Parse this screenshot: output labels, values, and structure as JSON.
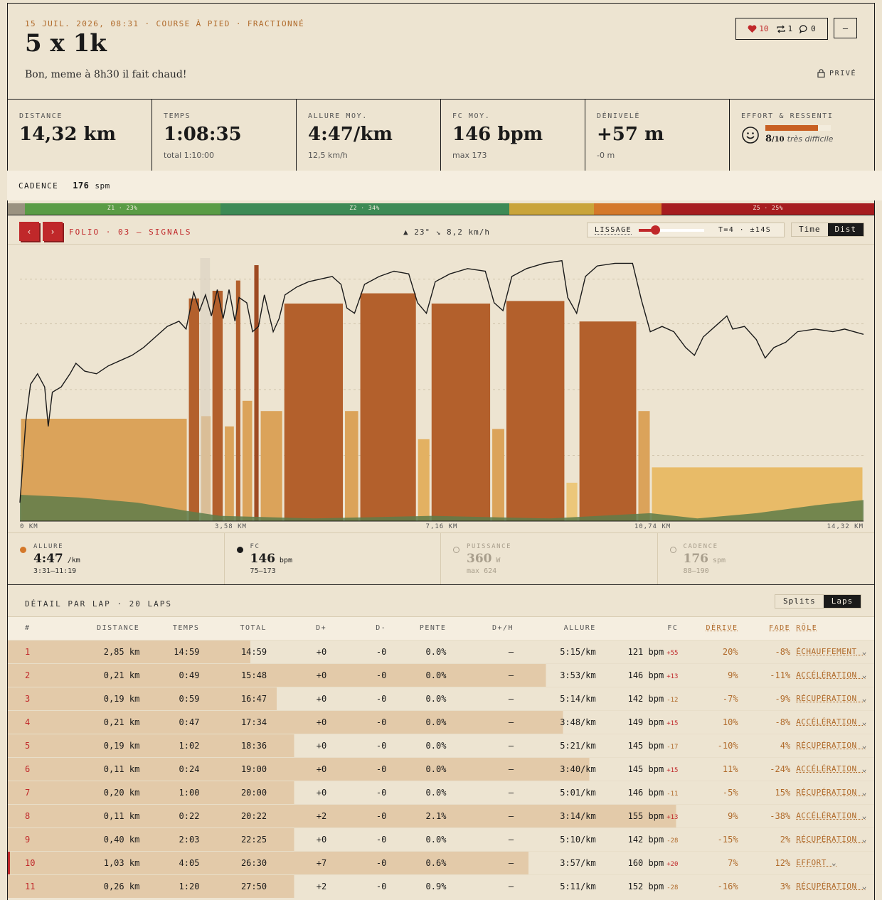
{
  "header": {
    "meta": "15 JUIL. 2026, 08:31 · COURSE À PIED · FRACTIONNÉ",
    "title": "5 x 1k",
    "description": "Bon, meme à 8h30 il fait chaud!",
    "likes": "10",
    "reposts": "1",
    "comments": "0",
    "menu_label": "–",
    "privacy": "PRIVÉ"
  },
  "stats": [
    {
      "label": "DISTANCE",
      "value": "14,32 km",
      "sub": ""
    },
    {
      "label": "TEMPS",
      "value": "1:08:35",
      "sub": "total 1:10:00"
    },
    {
      "label": "ALLURE MOY.",
      "value": "4:47/km",
      "sub": "12,5 km/h"
    },
    {
      "label": "FC MOY.",
      "value": "146 bpm",
      "sub": "max 173"
    },
    {
      "label": "DÉNIVELÉ",
      "value": "+57 m",
      "sub": "-0 m"
    }
  ],
  "effort": {
    "label": "EFFORT & RESSENTI",
    "score": "8",
    "scale": "/10",
    "text": "très difficile",
    "level": 0.8
  },
  "cadence_row": {
    "label": "CADENCE",
    "value": "176",
    "unit": "spm"
  },
  "zones": [
    {
      "label": "",
      "share": 2,
      "color": "#9a9280"
    },
    {
      "label": "Z1 · 23%",
      "share": 23,
      "color": "#5a9c45"
    },
    {
      "label": "Z2 · 34%",
      "share": 34,
      "color": "#3d8a55"
    },
    {
      "label": "",
      "share": 10,
      "color": "#c9a43a"
    },
    {
      "label": "",
      "share": 8,
      "color": "#d4782a"
    },
    {
      "label": "Z5 · 25%",
      "share": 25,
      "color": "#a61c1e"
    }
  ],
  "toolbar": {
    "prev": "‹",
    "next": "›",
    "folio": "FOLIO · 03 — SIGNALS",
    "weather": "▲ 23° ↘ 8,2 km/h",
    "lissage_label": "LISSAGE",
    "lissage_value": "T=4 · ±14S",
    "lissage_level": 0.25,
    "time_label": "Time",
    "dist_label": "Dist"
  },
  "chart_data": {
    "type": "bar",
    "x_axis_labels": [
      "0 KM",
      "3,58 KM",
      "7,16 KM",
      "10,74 KM",
      "14,32 KM"
    ],
    "xlim": [
      0,
      14.32
    ],
    "pace_bars": [
      {
        "start": 0.0,
        "end": 2.85,
        "pace": "5:15",
        "level": 0.4,
        "color": "#dba35a"
      },
      {
        "start": 2.85,
        "end": 3.06,
        "pace": "3:53",
        "level": 0.87,
        "color": "#b3602c"
      },
      {
        "start": 3.06,
        "end": 3.25,
        "pace": "5:14",
        "level": 0.41,
        "color": "#dba35a"
      },
      {
        "start": 3.25,
        "end": 3.46,
        "pace": "3:48",
        "level": 0.9,
        "color": "#b3602c"
      },
      {
        "start": 3.46,
        "end": 3.65,
        "pace": "5:21",
        "level": 0.37,
        "color": "#dba35a"
      },
      {
        "start": 3.65,
        "end": 3.76,
        "pace": "3:40",
        "level": 0.94,
        "color": "#b3602c"
      },
      {
        "start": 3.76,
        "end": 3.96,
        "pace": "5:01",
        "level": 0.47,
        "color": "#dba35a"
      },
      {
        "start": 3.96,
        "end": 4.07,
        "pace": "3:14",
        "level": 1.0,
        "color": "#9e4a22"
      },
      {
        "start": 4.07,
        "end": 4.47,
        "pace": "5:10",
        "level": 0.43,
        "color": "#dba35a"
      },
      {
        "start": 4.47,
        "end": 5.5,
        "pace": "3:57",
        "level": 0.85,
        "color": "#b3602c"
      },
      {
        "start": 5.5,
        "end": 5.76,
        "pace": "5:11",
        "level": 0.43,
        "color": "#dba35a"
      },
      {
        "start": 5.76,
        "end": 6.74,
        "pace": "3:55",
        "level": 0.89,
        "color": "#b3602c"
      },
      {
        "start": 6.74,
        "end": 6.97,
        "pace": "5:35",
        "level": 0.32,
        "color": "#e3b162"
      },
      {
        "start": 6.97,
        "end": 8.0,
        "pace": "3:58",
        "level": 0.85,
        "color": "#b3602c"
      },
      {
        "start": 8.0,
        "end": 8.24,
        "pace": "5:28",
        "level": 0.36,
        "color": "#dba35a"
      },
      {
        "start": 8.24,
        "end": 9.26,
        "pace": "3:56",
        "level": 0.86,
        "color": "#b3602c"
      },
      {
        "start": 9.26,
        "end": 9.48,
        "pace": "6:05",
        "level": 0.15,
        "color": "#ecc77a"
      },
      {
        "start": 9.48,
        "end": 10.48,
        "pace": "4:02",
        "level": 0.78,
        "color": "#b3602c"
      },
      {
        "start": 10.48,
        "end": 10.71,
        "pace": "5:08",
        "level": 0.43,
        "color": "#dba35a"
      },
      {
        "start": 10.71,
        "end": 14.32,
        "pace": "5:35",
        "level": 0.21,
        "color": "#e8bb68"
      }
    ],
    "hr_trace": [
      [
        0,
        0.07
      ],
      [
        0.1,
        0.38
      ],
      [
        0.18,
        0.52
      ],
      [
        0.3,
        0.56
      ],
      [
        0.42,
        0.51
      ],
      [
        0.48,
        0.36
      ],
      [
        0.55,
        0.49
      ],
      [
        0.7,
        0.51
      ],
      [
        0.85,
        0.56
      ],
      [
        0.95,
        0.6
      ],
      [
        1.1,
        0.57
      ],
      [
        1.3,
        0.56
      ],
      [
        1.5,
        0.59
      ],
      [
        1.7,
        0.61
      ],
      [
        1.9,
        0.63
      ],
      [
        2.1,
        0.66
      ],
      [
        2.3,
        0.7
      ],
      [
        2.5,
        0.74
      ],
      [
        2.7,
        0.76
      ],
      [
        2.82,
        0.73
      ],
      [
        2.95,
        0.87
      ],
      [
        3.05,
        0.8
      ],
      [
        3.15,
        0.86
      ],
      [
        3.25,
        0.78
      ],
      [
        3.35,
        0.88
      ],
      [
        3.45,
        0.77
      ],
      [
        3.55,
        0.88
      ],
      [
        3.65,
        0.76
      ],
      [
        3.72,
        0.85
      ],
      [
        3.85,
        0.83
      ],
      [
        3.95,
        0.72
      ],
      [
        4.05,
        0.74
      ],
      [
        4.15,
        0.86
      ],
      [
        4.3,
        0.72
      ],
      [
        4.4,
        0.77
      ],
      [
        4.5,
        0.86
      ],
      [
        4.7,
        0.89
      ],
      [
        4.9,
        0.91
      ],
      [
        5.1,
        0.92
      ],
      [
        5.3,
        0.93
      ],
      [
        5.45,
        0.9
      ],
      [
        5.55,
        0.81
      ],
      [
        5.68,
        0.79
      ],
      [
        5.85,
        0.9
      ],
      [
        6.1,
        0.93
      ],
      [
        6.35,
        0.95
      ],
      [
        6.6,
        0.94
      ],
      [
        6.75,
        0.83
      ],
      [
        6.9,
        0.79
      ],
      [
        7.05,
        0.91
      ],
      [
        7.3,
        0.94
      ],
      [
        7.6,
        0.96
      ],
      [
        7.9,
        0.95
      ],
      [
        8.05,
        0.83
      ],
      [
        8.2,
        0.8
      ],
      [
        8.35,
        0.93
      ],
      [
        8.6,
        0.96
      ],
      [
        8.9,
        0.98
      ],
      [
        9.2,
        0.99
      ],
      [
        9.3,
        0.85
      ],
      [
        9.45,
        0.79
      ],
      [
        9.6,
        0.93
      ],
      [
        9.8,
        0.97
      ],
      [
        10.1,
        0.98
      ],
      [
        10.4,
        0.98
      ],
      [
        10.55,
        0.84
      ],
      [
        10.7,
        0.72
      ],
      [
        10.9,
        0.74
      ],
      [
        11.1,
        0.72
      ],
      [
        11.3,
        0.66
      ],
      [
        11.45,
        0.63
      ],
      [
        11.6,
        0.7
      ],
      [
        11.8,
        0.74
      ],
      [
        12.0,
        0.78
      ],
      [
        12.1,
        0.73
      ],
      [
        12.3,
        0.74
      ],
      [
        12.5,
        0.69
      ],
      [
        12.65,
        0.62
      ],
      [
        12.8,
        0.66
      ],
      [
        13.0,
        0.68
      ],
      [
        13.2,
        0.72
      ],
      [
        13.5,
        0.73
      ],
      [
        13.8,
        0.72
      ],
      [
        14.0,
        0.73
      ],
      [
        14.32,
        0.71
      ]
    ],
    "elevation_fill": [
      [
        0,
        0.1
      ],
      [
        1,
        0.09
      ],
      [
        2,
        0.07
      ],
      [
        2.8,
        0.04
      ],
      [
        3.4,
        0.02
      ],
      [
        5,
        0.01
      ],
      [
        7,
        0.02
      ],
      [
        9,
        0.01
      ],
      [
        10.7,
        0.03
      ],
      [
        11.5,
        0.01
      ],
      [
        12.5,
        0.03
      ],
      [
        13.5,
        0.06
      ],
      [
        14.32,
        0.08
      ]
    ]
  },
  "metrics": [
    {
      "label": "ALLURE",
      "value": "4:47",
      "unit": "/km",
      "range": "3:31–11:19",
      "color": "#d4782a",
      "active": true
    },
    {
      "label": "FC",
      "value": "146",
      "unit": "bpm",
      "range": "75–173",
      "color": "#1a1a1a",
      "active": true
    },
    {
      "label": "PUISSANCE",
      "value": "360",
      "unit": "W",
      "range": "max 624",
      "color": "",
      "active": false
    },
    {
      "label": "CADENCE",
      "value": "176",
      "unit": "spm",
      "range": "88–190",
      "color": "",
      "active": false
    }
  ],
  "laps": {
    "title": "DÉTAIL PAR LAP · 20 LAPS",
    "splits_label": "Splits",
    "laps_label": "Laps",
    "columns": [
      "#",
      "DISTANCE",
      "TEMPS",
      "TOTAL",
      "D+",
      "D-",
      "PENTE",
      "D+/H",
      "ALLURE",
      "FC",
      "DÉRIVE",
      "FADE",
      "RÔLE"
    ],
    "rows": [
      {
        "n": "1",
        "dist": "2,85 km",
        "time": "14:59",
        "total": "14:59",
        "dp": "+0",
        "dm": "-0",
        "slope": "0.0%",
        "dph": "–",
        "pace": "5:15/km",
        "hr": "121 bpm",
        "hrd": "+55",
        "drift": "20%",
        "fade": "-8%",
        "role": "ÉCHAUFFEMENT",
        "shade": 0.28
      },
      {
        "n": "2",
        "dist": "0,21 km",
        "time": "0:49",
        "total": "15:48",
        "dp": "+0",
        "dm": "-0",
        "slope": "0.0%",
        "dph": "–",
        "pace": "3:53/km",
        "hr": "146 bpm",
        "hrd": "+13",
        "drift": "9%",
        "fade": "-11%",
        "role": "ACCÉLÉRATION",
        "shade": 0.62
      },
      {
        "n": "3",
        "dist": "0,19 km",
        "time": "0:59",
        "total": "16:47",
        "dp": "+0",
        "dm": "-0",
        "slope": "0.0%",
        "dph": "–",
        "pace": "5:14/km",
        "hr": "142 bpm",
        "hrd": "-12",
        "drift": "-7%",
        "fade": "-9%",
        "role": "RÉCUPÉRATION",
        "shade": 0.31
      },
      {
        "n": "4",
        "dist": "0,21 km",
        "time": "0:47",
        "total": "17:34",
        "dp": "+0",
        "dm": "-0",
        "slope": "0.0%",
        "dph": "–",
        "pace": "3:48/km",
        "hr": "149 bpm",
        "hrd": "+15",
        "drift": "10%",
        "fade": "-8%",
        "role": "ACCÉLÉRATION",
        "shade": 0.64
      },
      {
        "n": "5",
        "dist": "0,19 km",
        "time": "1:02",
        "total": "18:36",
        "dp": "+0",
        "dm": "-0",
        "slope": "0.0%",
        "dph": "–",
        "pace": "5:21/km",
        "hr": "145 bpm",
        "hrd": "-17",
        "drift": "-10%",
        "fade": "4%",
        "role": "RÉCUPÉRATION",
        "shade": 0.33
      },
      {
        "n": "6",
        "dist": "0,11 km",
        "time": "0:24",
        "total": "19:00",
        "dp": "+0",
        "dm": "-0",
        "slope": "0.0%",
        "dph": "–",
        "pace": "3:40/km",
        "hr": "145 bpm",
        "hrd": "+15",
        "drift": "11%",
        "fade": "-24%",
        "role": "ACCÉLÉRATION",
        "shade": 0.67
      },
      {
        "n": "7",
        "dist": "0,20 km",
        "time": "1:00",
        "total": "20:00",
        "dp": "+0",
        "dm": "-0",
        "slope": "0.0%",
        "dph": "–",
        "pace": "5:01/km",
        "hr": "146 bpm",
        "hrd": "-11",
        "drift": "-5%",
        "fade": "15%",
        "role": "RÉCUPÉRATION",
        "shade": 0.33
      },
      {
        "n": "8",
        "dist": "0,11 km",
        "time": "0:22",
        "total": "20:22",
        "dp": "+2",
        "dm": "-0",
        "slope": "2.1%",
        "dph": "–",
        "pace": "3:14/km",
        "hr": "155 bpm",
        "hrd": "+13",
        "drift": "9%",
        "fade": "-38%",
        "role": "ACCÉLÉRATION",
        "shade": 0.77
      },
      {
        "n": "9",
        "dist": "0,40 km",
        "time": "2:03",
        "total": "22:25",
        "dp": "+0",
        "dm": "-0",
        "slope": "0.0%",
        "dph": "–",
        "pace": "5:10/km",
        "hr": "142 bpm",
        "hrd": "-28",
        "drift": "-15%",
        "fade": "2%",
        "role": "RÉCUPÉRATION",
        "shade": 0.33
      },
      {
        "n": "10",
        "dist": "1,03 km",
        "time": "4:05",
        "total": "26:30",
        "dp": "+7",
        "dm": "-0",
        "slope": "0.6%",
        "dph": "–",
        "pace": "3:57/km",
        "hr": "160 bpm",
        "hrd": "+20",
        "drift": "7%",
        "fade": "12%",
        "role": "EFFORT",
        "shade": 0.6,
        "highlight": true
      },
      {
        "n": "11",
        "dist": "0,26 km",
        "time": "1:20",
        "total": "27:50",
        "dp": "+2",
        "dm": "-0",
        "slope": "0.9%",
        "dph": "–",
        "pace": "5:11/km",
        "hr": "152 bpm",
        "hrd": "-28",
        "drift": "-16%",
        "fade": "3%",
        "role": "RÉCUPÉRATION",
        "shade": 0.33
      }
    ]
  },
  "colors": {
    "accent": "#c0282a",
    "bg": "#ede4d1",
    "hr_up": "#c0282a",
    "hr_down": "#b06a2a"
  }
}
